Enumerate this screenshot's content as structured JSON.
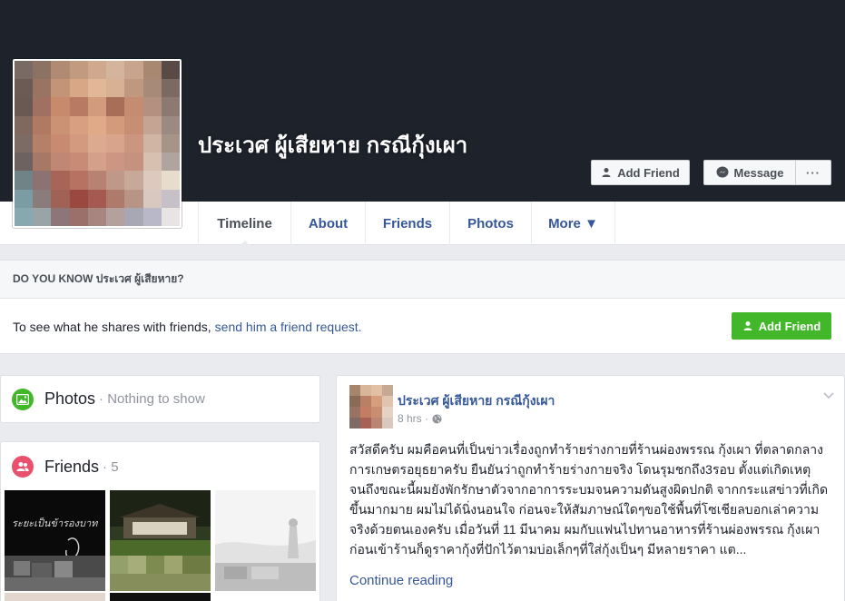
{
  "profile": {
    "name": "ประเวศ ผู้เสียหาย กรณีกุ้งเผา",
    "add_friend_label": "Add Friend",
    "message_label": "Message",
    "more_label": "···"
  },
  "tabs": [
    {
      "label": "Timeline"
    },
    {
      "label": "About"
    },
    {
      "label": "Friends"
    },
    {
      "label": "Photos"
    },
    {
      "label": "More ▼"
    }
  ],
  "do_you_know": {
    "header": "DO YOU KNOW ประเวศ ผู้เสียหาย?",
    "text": "To see what he shares with friends,",
    "link": "send him a friend request.",
    "button_label": "Add Friend"
  },
  "photos_card": {
    "title": "Photos",
    "subtitle": "· Nothing to show"
  },
  "friends_card": {
    "title": "Friends",
    "count": "· 5"
  },
  "post": {
    "author": "ประเวศ ผู้เสียหาย กรณีกุ้งเผา",
    "time": "8 hrs ·",
    "text": "สวัสดีครับ ผมคือคนที่เป็นข่าวเรื่องถูกทำร้ายร่างกายที่ร้านผ่องพรรณ กุ้งเผา ที่ตลาดกลางการเกษตรอยุธยาครับ ยืนยันว่าถูกทำร้ายร่างกายจริง โดนรุมชกถึง3รอบ ตั้งแต่เกิดเหตุจนถึงขณะนี้ผมยังพักรักษาตัวจากอาการระบมจนความดันสูงผิดปกติ จากกระแสข่าวที่เกิดขึ้นมากมาย ผมไม่ได้นิ่งนอนใจ ก่อนจะให้สัมภาษณ์ใดๆขอใช้พื้นที่โซเชียลบอกเล่าความจริงด้วยตนเองครับ เมื่อวันที่ 11 มีนาคม ผมกับแฟนไปทานอาหารที่ร้านผ่องพรรณ กุ้งเผา ก่อนเข้าร้านก็ดูราคากุ้งที่ปักไว้ตามบ่อเล็กๆที่ใส่กุ้งเป็นๆ มีหลายราคา แต...",
    "continue_label": "Continue reading"
  },
  "icons": {
    "add_friend": "add-friend-icon",
    "messenger": "messenger-icon",
    "photos": "photos-icon",
    "friends": "friends-icon",
    "globe": "globe-icon",
    "chevron": "chevron-down-icon"
  },
  "colors": {
    "cover": "#1d222b",
    "link": "#365899",
    "green": "#42b72a",
    "photos_icon": "#42b72a",
    "friends_icon": "#e9506e"
  }
}
